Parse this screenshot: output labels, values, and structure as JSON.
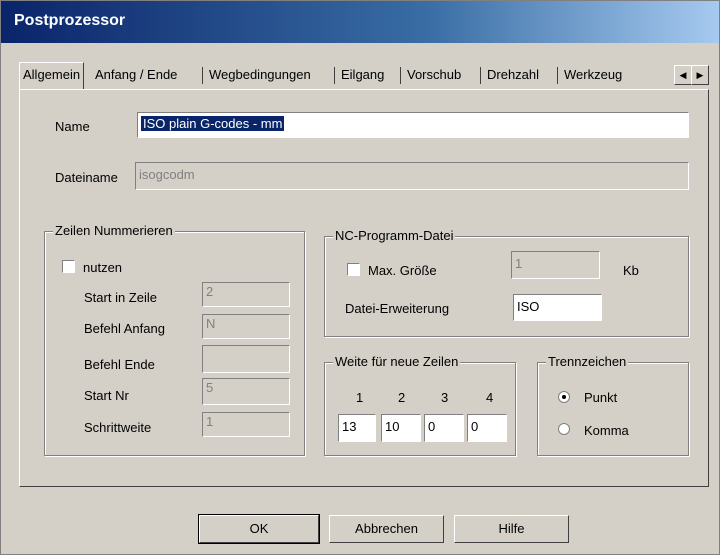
{
  "window": {
    "title": "Postprozessor"
  },
  "tabs": [
    "Allgemein",
    "Anfang / Ende",
    "Wegbedingungen",
    "Eilgang",
    "Vorschub",
    "Drehzahl",
    "Werkzeug"
  ],
  "general": {
    "name_label": "Name",
    "name_value": "ISO plain G-codes - mm",
    "filename_label": "Dateiname",
    "filename_value": "isogcodm"
  },
  "line_numbering": {
    "title": "Zeilen Nummerieren",
    "use_label": "nutzen",
    "use_checked": false,
    "start_line_label": "Start in Zeile",
    "start_line_value": "2",
    "cmd_start_label": "Befehl Anfang",
    "cmd_start_value": "N",
    "cmd_end_label": "Befehl Ende",
    "cmd_end_value": "",
    "start_no_label": "Start Nr",
    "start_no_value": "5",
    "step_label": "Schrittweite",
    "step_value": "1"
  },
  "nc_file": {
    "title": "NC-Programm-Datei",
    "max_size_label": "Max. Größe",
    "max_size_checked": false,
    "max_size_value": "1",
    "unit": "Kb",
    "extension_label": "Datei-Erweiterung",
    "extension_value": "ISO"
  },
  "widths": {
    "title": "Weite für neue Zeilen",
    "headers": [
      "1",
      "2",
      "3",
      "4"
    ],
    "values": [
      "13",
      "10",
      "0",
      "0"
    ]
  },
  "separator": {
    "title": "Trennzeichen",
    "options": [
      "Punkt",
      "Komma"
    ],
    "selected": "Punkt"
  },
  "buttons": {
    "ok": "OK",
    "cancel": "Abbrechen",
    "help": "Hilfe"
  }
}
